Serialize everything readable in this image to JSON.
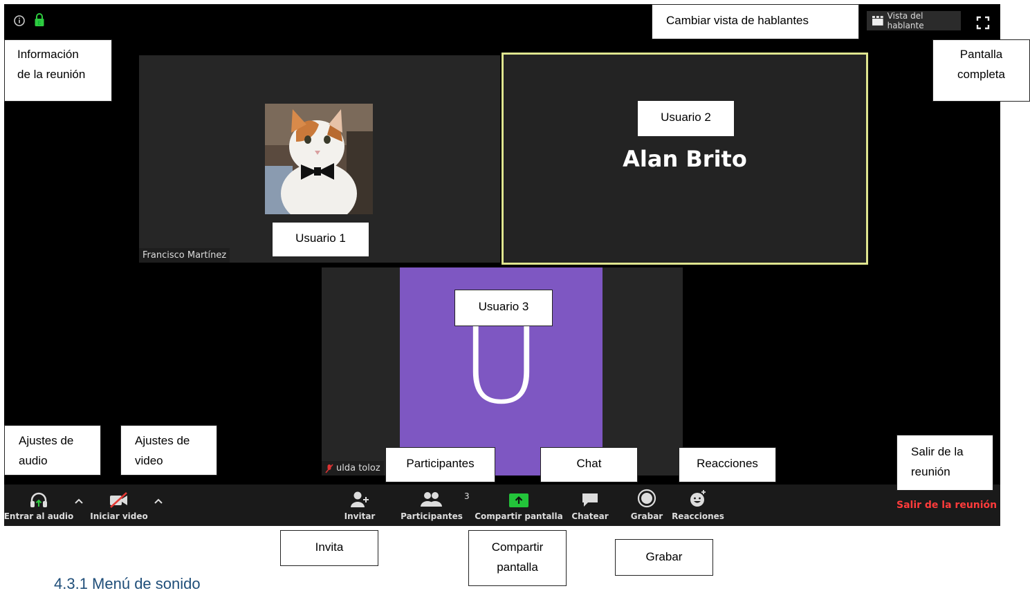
{
  "participants": {
    "user1_name": "Francisco Martínez",
    "user2_name": "Alan Brito",
    "user3_name": "ulda toloz",
    "user3_initial": "U",
    "participant_count": "3"
  },
  "top_bar": {
    "speaker_view_label": "Vista del hablante",
    "lock_badge": "E"
  },
  "toolbar": {
    "join_audio": "Entrar al audio",
    "start_video": "Iniciar video",
    "invite": "Invitar",
    "participants": "Participantes",
    "share_screen": "Compartir pantalla",
    "chat": "Chatear",
    "record": "Grabar",
    "reactions": "Reacciones",
    "leave": "Salir de la reunión"
  },
  "callouts": {
    "meeting_info": [
      "Información",
      "de la reunión"
    ],
    "change_view": "Cambiar vista de hablantes",
    "fullscreen": [
      "Pantalla",
      "completa"
    ],
    "user1": "Usuario  1",
    "user2": "Usuario 2",
    "user3": "Usuario 3",
    "audio_settings": [
      "Ajustes de",
      "audio"
    ],
    "video_settings": [
      "Ajustes de",
      "video"
    ],
    "participants": "Participantes",
    "chat": "Chat",
    "reactions": "Reacciones",
    "leave": [
      "Salir de la",
      "reunión"
    ],
    "invite": "Invita",
    "share_screen": [
      "Compartir",
      "pantalla"
    ],
    "record": "Grabar"
  },
  "caption": "4.3.1 Menú de sonido",
  "colors": {
    "active_speaker_border": "#dfe58f",
    "avatar_purple": "#7e57c2",
    "share_green": "#23c43a",
    "leave_red": "#ff3b3b"
  }
}
